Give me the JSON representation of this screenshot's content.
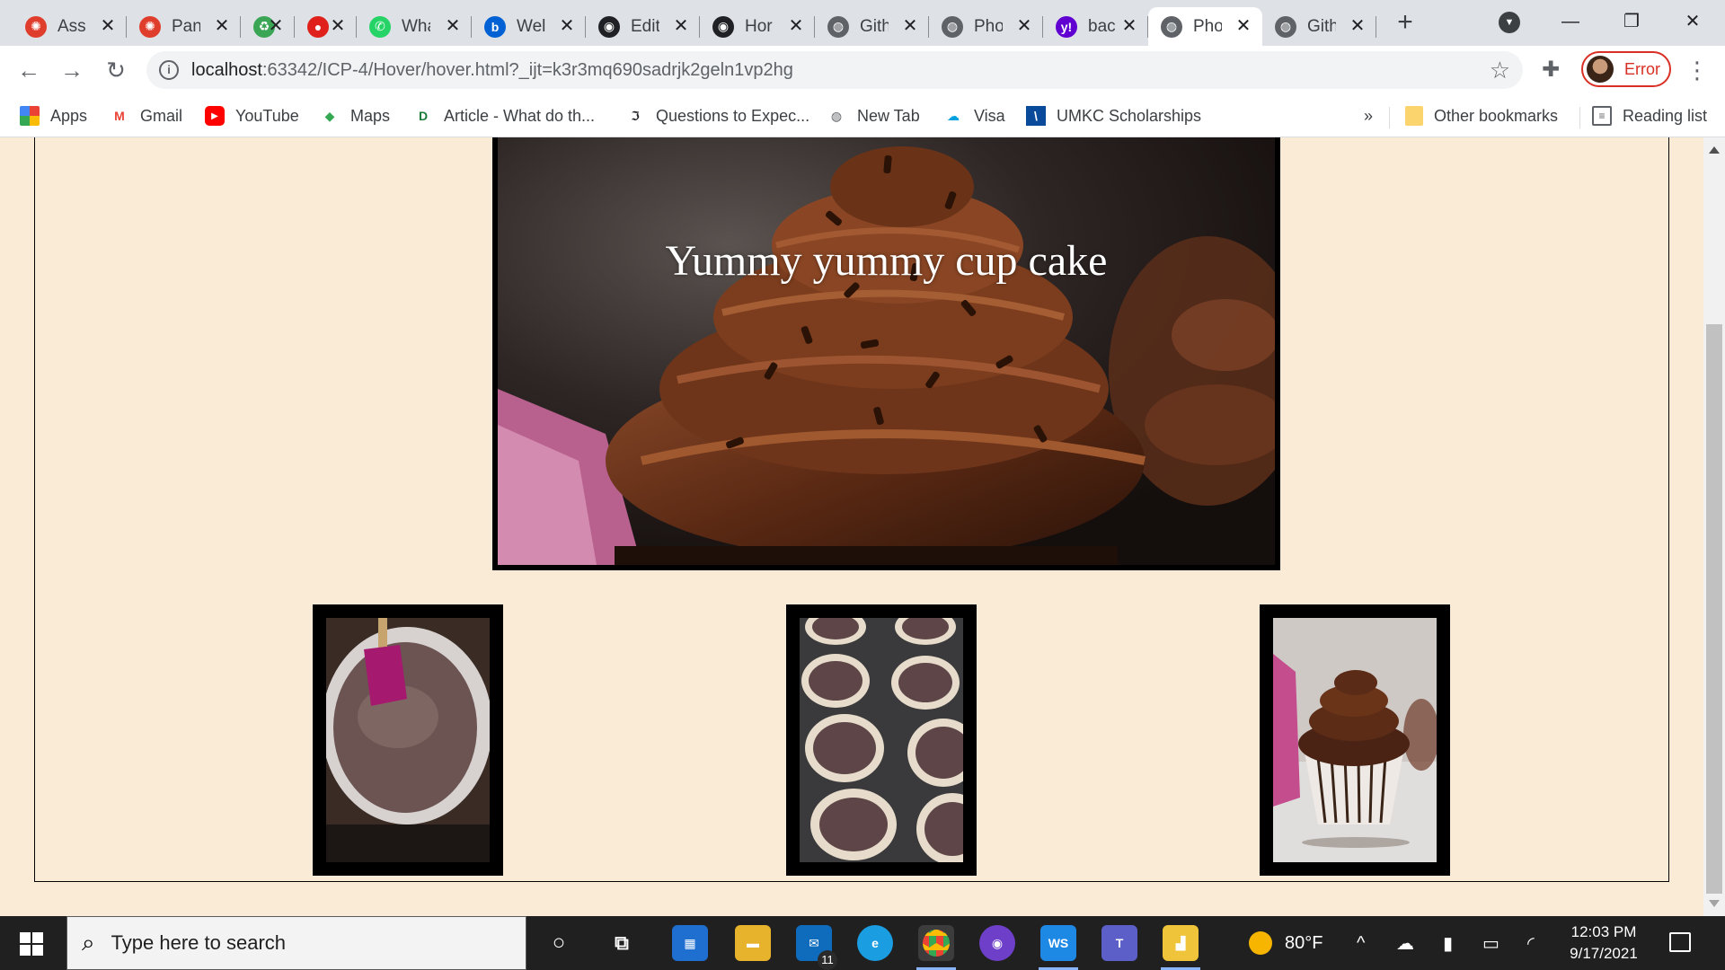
{
  "browser": {
    "tabs": [
      {
        "label": "Assi",
        "icon": "canvas-icon",
        "color": "#e03e2d"
      },
      {
        "label": "Pan",
        "icon": "canvas-icon",
        "color": "#e03e2d"
      },
      {
        "label": "",
        "icon": "recycle-icon",
        "color": "#3aa655"
      },
      {
        "label": "",
        "icon": "record-icon",
        "color": "#e0201b"
      },
      {
        "label": "Wha",
        "icon": "whatsapp-icon",
        "color": "#25d366"
      },
      {
        "label": "Wel",
        "icon": "box-icon",
        "color": "#0061d5"
      },
      {
        "label": "Edit",
        "icon": "github-icon",
        "color": "#202124"
      },
      {
        "label": "Hor",
        "icon": "github-icon",
        "color": "#202124"
      },
      {
        "label": "Gith",
        "icon": "globe-icon",
        "color": "#5f6368"
      },
      {
        "label": "Pho",
        "icon": "globe-icon",
        "color": "#5f6368"
      },
      {
        "label": "bac",
        "icon": "yahoo-icon",
        "color": "#6001d2"
      },
      {
        "label": "Pho",
        "icon": "globe-icon",
        "color": "#5f6368",
        "active": true
      },
      {
        "label": "Gith",
        "icon": "globe-icon",
        "color": "#5f6368"
      }
    ],
    "url_host": "localhost",
    "url_rest": ":63342/ICP-4/Hover/hover.html?_ijt=k3r3mq690sadrjk2geln1vp2hg",
    "profile_label": "Error",
    "bookmarks": [
      {
        "label": "Apps",
        "icon": "apps-grid-icon"
      },
      {
        "label": "Gmail",
        "icon": "gmail-icon"
      },
      {
        "label": "YouTube",
        "icon": "youtube-icon"
      },
      {
        "label": "Maps",
        "icon": "maps-pin-icon"
      },
      {
        "label": "Article - What do th...",
        "icon": "article-icon"
      },
      {
        "label": "Questions to Expec...",
        "icon": "questions-icon"
      },
      {
        "label": "New Tab",
        "icon": "globe-icon"
      },
      {
        "label": "Visa",
        "icon": "salesforce-cloud-icon"
      },
      {
        "label": "UMKC Scholarships",
        "icon": "umkc-icon"
      }
    ],
    "bookmarks_overflow": "»",
    "other_bookmarks": "Other bookmarks",
    "reading_list": "Reading list"
  },
  "page": {
    "hero_title": "Yummy yummy cup cake",
    "colors": {
      "background": "#faebd7",
      "frame": "#000000"
    },
    "thumbnails": [
      {
        "subject": "batter-bowl"
      },
      {
        "subject": "cupcake-tin"
      },
      {
        "subject": "frosted-cupcake"
      }
    ]
  },
  "taskbar": {
    "search_placeholder": "Type here to search",
    "weather": "80°F",
    "time": "12:03 PM",
    "date": "9/17/2021",
    "mail_badge": "11"
  }
}
